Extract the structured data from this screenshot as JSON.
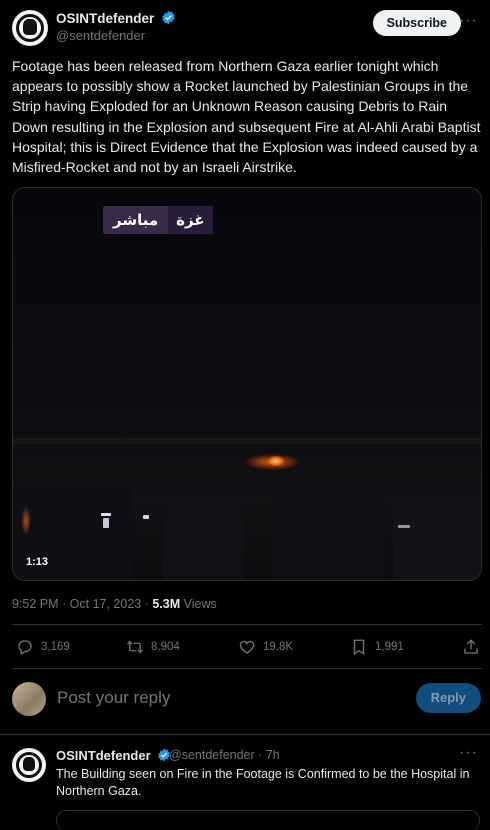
{
  "author": {
    "name": "OSINTdefender",
    "handle": "@sentdefender",
    "subscribe_label": "Subscribe",
    "more": "···"
  },
  "tweet": {
    "text": "Footage has been released from Northern Gaza earlier tonight which appears to possibly show a Rocket launched by Palestinian Groups in the Strip having Exploded for an Unknown Reason causing Debris to Rain Down resulting in the Explosion and subsequent Fire at Al-Ahli Arabi Baptist Hospital; this is Direct Evidence that the Explosion was indeed caused by a Misfired-Rocket and not by an Israeli Airstrike.",
    "video": {
      "overlay_word1": "غزة",
      "overlay_word2": "مباشر",
      "duration": "1:13"
    },
    "time": "9:52 PM · Oct 17, 2023 · ",
    "views_count": "5.3M",
    "views_label": " Views"
  },
  "actions": {
    "replies": "3,169",
    "reposts": "8,904",
    "likes": "19.8K",
    "bookmarks": "1,991"
  },
  "reply_box": {
    "placeholder": "Post your reply",
    "button": "Reply"
  },
  "reply_tweet": {
    "name": "OSINTdefender",
    "handle_time": "@sentdefender · 7h",
    "more": "···",
    "text": "The Building seen on Fire in the Footage is Confirmed to be the Hospital in Northern Gaza."
  },
  "colors": {
    "background": "#000000",
    "verified": "#1d9bf0",
    "muted": "#71767b",
    "reply_button": "#0f4e7f"
  }
}
